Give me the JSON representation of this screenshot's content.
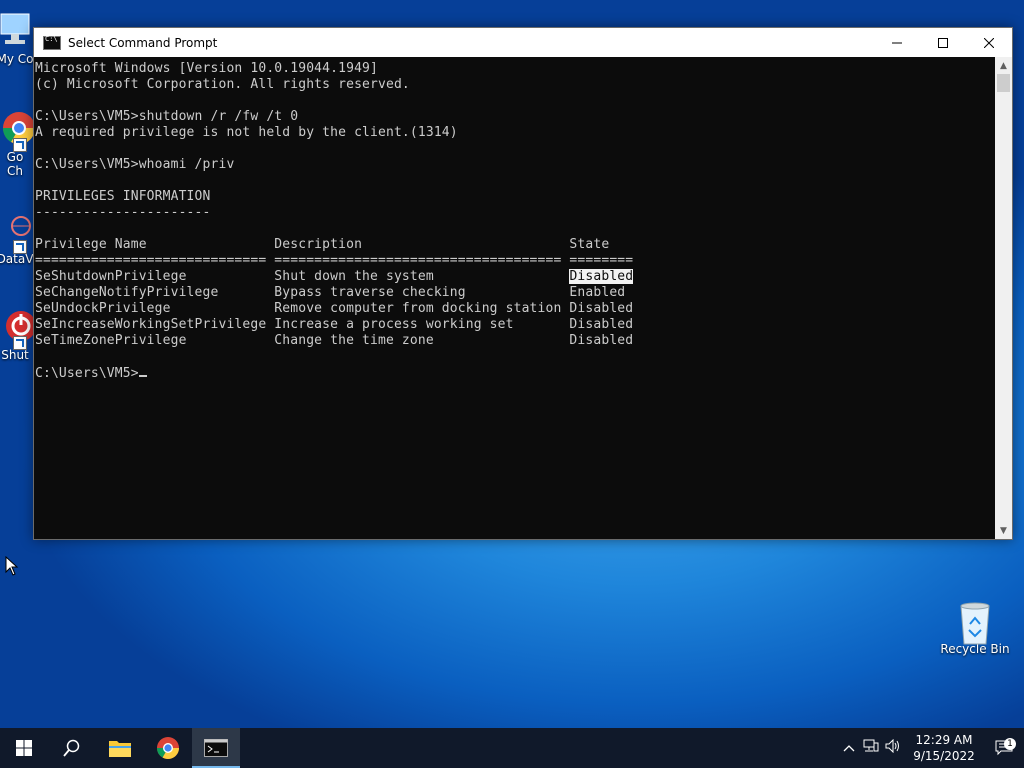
{
  "window": {
    "title": "Select Command Prompt",
    "console": {
      "lines": [
        "Microsoft Windows [Version 10.0.19044.1949]",
        "(c) Microsoft Corporation. All rights reserved.",
        "",
        "C:\\Users\\VM5>shutdown /r /fw /t 0",
        "A required privilege is not held by the client.(1314)",
        "",
        "C:\\Users\\VM5>whoami /priv",
        "",
        "PRIVILEGES INFORMATION",
        "----------------------",
        "",
        "Privilege Name                Description                          State",
        "============================= ==================================== ========",
        "SeShutdownPrivilege           Shut down the system                 ",
        "SeChangeNotifyPrivilege       Bypass traverse checking             Enabled",
        "SeUndockPrivilege             Remove computer from docking station Disabled",
        "SeIncreaseWorkingSetPrivilege Increase a process working set       Disabled",
        "SeTimeZonePrivilege           Change the time zone                 Disabled",
        "",
        "C:\\Users\\VM5>"
      ],
      "selected_text": "Disabled"
    }
  },
  "desktop": {
    "icons": [
      {
        "label": "My Co"
      },
      {
        "label": "Go\nCh"
      },
      {
        "label": "DataV"
      },
      {
        "label": "Shut"
      },
      {
        "label": "Recycle Bin"
      }
    ]
  },
  "taskbar": {
    "clock_time": "12:29 AM",
    "clock_date": "9/15/2022",
    "notification_count": "1"
  },
  "colors": {
    "console_bg": "#0c0c0c",
    "console_fg": "#cccccc",
    "taskbar_bg": "#10192a",
    "accent": "#76b9ed"
  }
}
